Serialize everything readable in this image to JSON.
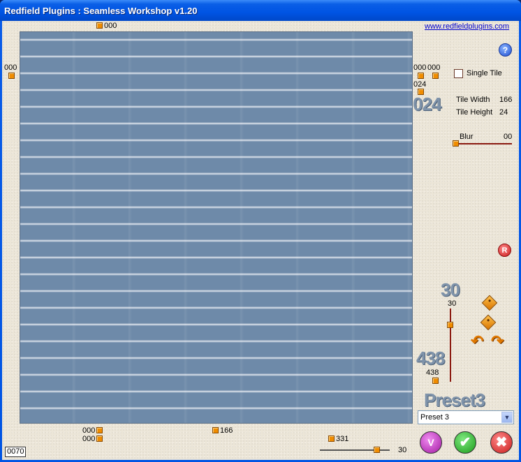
{
  "window": {
    "title": "Redfield Plugins : Seamless Workshop v1.20"
  },
  "link": {
    "label": "www.redfieldplugins.com"
  },
  "help": {
    "label": "?"
  },
  "canvas": {
    "top_offset_label": "000",
    "left_offset_label": "000",
    "right_offset_labels": [
      "000",
      "000",
      "024"
    ],
    "bottom_labels": [
      "000",
      "000",
      "166",
      "331"
    ]
  },
  "tile": {
    "big_value": "024",
    "single_tile_label": "Single Tile",
    "single_tile_checked": false,
    "width_label": "Tile Width",
    "width_value": "166",
    "height_label": "Tile Height",
    "height_value": "24"
  },
  "blur": {
    "label": "Blur",
    "value": "00"
  },
  "reset": {
    "label": "R"
  },
  "param1": {
    "big": "30",
    "value": "30"
  },
  "param2": {
    "big": "438",
    "value": "438"
  },
  "bottom_slider": {
    "value": "30"
  },
  "preset": {
    "big": "Preset3",
    "selected": "Preset 3",
    "dropdown_icon": "chevron-down-icon"
  },
  "actions": {
    "randomize_label": "V",
    "ok_label": "✔",
    "cancel_label": "✖"
  },
  "status": {
    "counter": "0070"
  },
  "colors": {
    "titlebar": "#0054e3",
    "panel": "#ece6d8",
    "accent": "#f08c00",
    "canvas": "#6d8aa9"
  }
}
